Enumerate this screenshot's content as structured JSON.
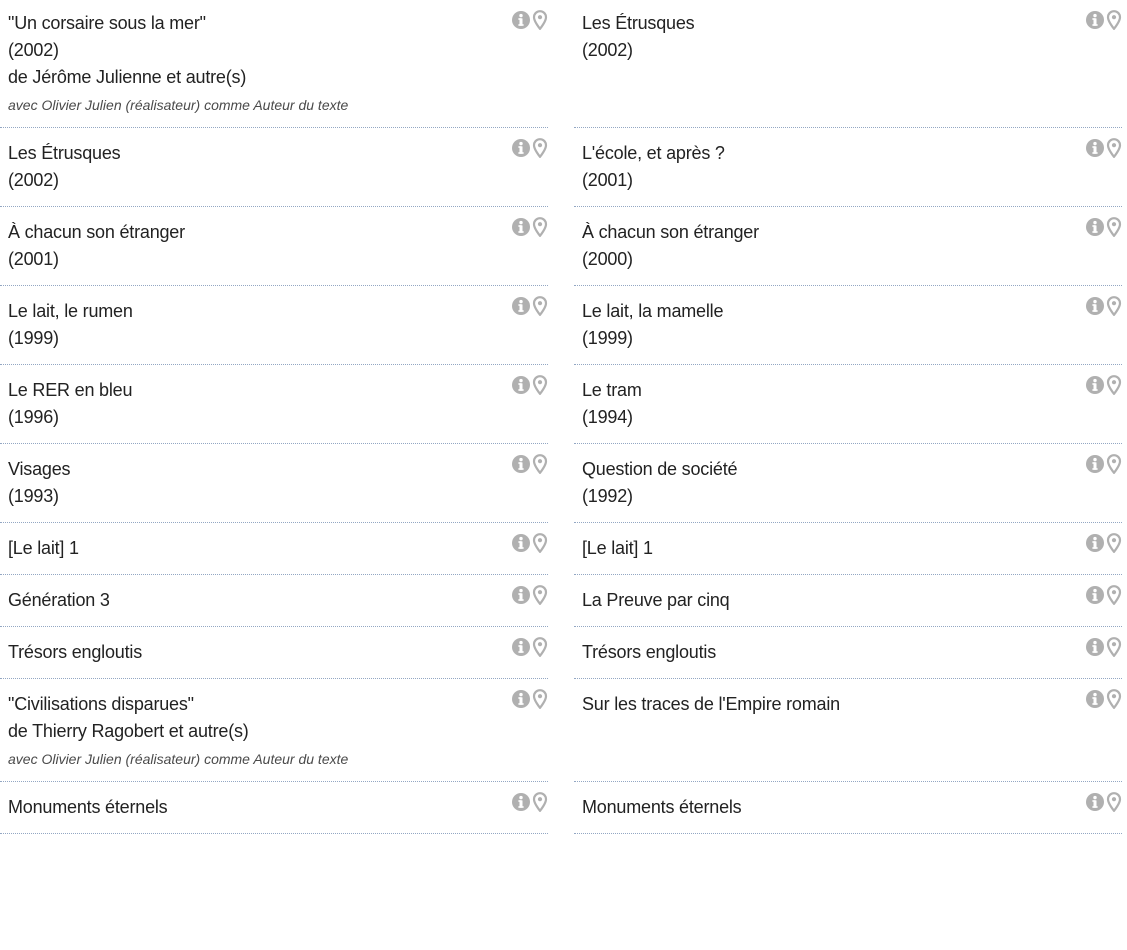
{
  "rows": [
    [
      {
        "title": "\"Un corsaire sous la mer\"",
        "year": "(2002)",
        "by": "de Jérôme Julienne et autre(s)",
        "note": "avec Olivier Julien (réalisateur) comme Auteur du texte"
      },
      {
        "title": "Les Étrusques",
        "year": "(2002)",
        "by": "",
        "note": ""
      }
    ],
    [
      {
        "title": "Les Étrusques",
        "year": "(2002)",
        "by": "",
        "note": ""
      },
      {
        "title": "L'école, et après ?",
        "year": "(2001)",
        "by": "",
        "note": ""
      }
    ],
    [
      {
        "title": "À chacun son étranger",
        "year": "(2001)",
        "by": "",
        "note": ""
      },
      {
        "title": "À chacun son étranger",
        "year": "(2000)",
        "by": "",
        "note": ""
      }
    ],
    [
      {
        "title": "Le lait, le rumen",
        "year": "(1999)",
        "by": "",
        "note": ""
      },
      {
        "title": "Le lait, la mamelle",
        "year": "(1999)",
        "by": "",
        "note": ""
      }
    ],
    [
      {
        "title": "Le RER en bleu",
        "year": "(1996)",
        "by": "",
        "note": ""
      },
      {
        "title": "Le tram",
        "year": "(1994)",
        "by": "",
        "note": ""
      }
    ],
    [
      {
        "title": "Visages",
        "year": "(1993)",
        "by": "",
        "note": ""
      },
      {
        "title": "Question de société",
        "year": "(1992)",
        "by": "",
        "note": ""
      }
    ],
    [
      {
        "title": "[Le lait] 1",
        "year": "",
        "by": "",
        "note": ""
      },
      {
        "title": "[Le lait] 1",
        "year": "",
        "by": "",
        "note": ""
      }
    ],
    [
      {
        "title": "Génération 3",
        "year": "",
        "by": "",
        "note": ""
      },
      {
        "title": "La Preuve par cinq",
        "year": "",
        "by": "",
        "note": ""
      }
    ],
    [
      {
        "title": "Trésors engloutis",
        "year": "",
        "by": "",
        "note": ""
      },
      {
        "title": "Trésors engloutis",
        "year": "",
        "by": "",
        "note": ""
      }
    ],
    [
      {
        "title": "\"Civilisations disparues\"",
        "year": "",
        "by": "de Thierry Ragobert et autre(s)",
        "note": "avec Olivier Julien (réalisateur) comme Auteur du texte"
      },
      {
        "title": "Sur les traces de l'Empire romain",
        "year": "",
        "by": "",
        "note": ""
      }
    ],
    [
      {
        "title": "Monuments éternels",
        "year": "",
        "by": "",
        "note": ""
      },
      {
        "title": "Monuments éternels",
        "year": "",
        "by": "",
        "note": ""
      }
    ]
  ],
  "icons": {
    "info": "info-icon",
    "location": "map-pin-icon",
    "color": "#b0b0b0"
  }
}
